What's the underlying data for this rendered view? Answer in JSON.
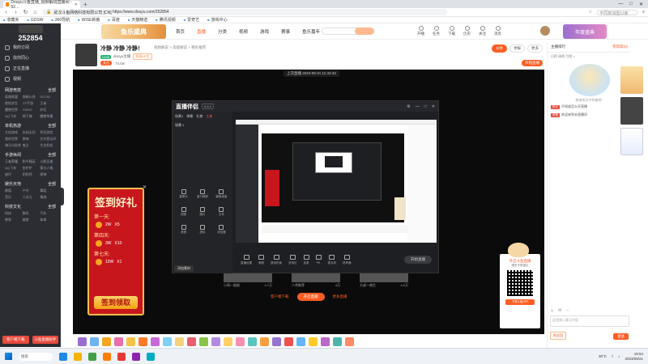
{
  "browser": {
    "tab_title": "Douyu斗鱼直播_视频解说直播间 - 52…",
    "url": "https://www.douyu.com/252854",
    "url_prefix": "武汉斗鱼网络科技有限公司 [CN]",
    "bookmarks": [
      "收藏夹",
      "GDSW",
      "360导航",
      "WISE新番",
      "百度",
      "天猫精选",
      "腾讯视频",
      "爱奇艺",
      "游戏中心"
    ],
    "search_placeholder": "不同意加盟13家"
  },
  "sidebar": {
    "room_number": "252854",
    "items": [
      "我的订阅",
      "找你同心",
      "正在直播",
      "视频"
    ],
    "groups": [
      {
        "title": "网游竞技",
        "more": "全部",
        "games": [
          "英雄联盟",
          "穿越火线",
          "DOTA2",
          "绝地求生",
          "CF手游",
          "王者",
          "魔兽世界",
          "CSGO",
          "炉石",
          "QQ飞车",
          "地下城",
          "魔兽争霸"
        ]
      },
      {
        "title": "单机热游",
        "more": "全部",
        "games": [
          "主机游戏",
          "永劫无间",
          "怀旧游戏",
          "我的世界",
          "原神",
          "艾尔登法环",
          "骑马与砍杀",
          "鬼泣",
          "生化危机"
        ]
      },
      {
        "title": "手游休闲",
        "more": "全部",
        "games": [
          "王者荣耀",
          "和平精英",
          "火影忍者",
          "QQ飞车",
          "金铲铲",
          "第五人格",
          "崩坏",
          "阴阳师",
          "原神"
        ]
      },
      {
        "title": "娱乐天地",
        "more": "全部",
        "games": [
          "颜值",
          "户外",
          "舞蹈",
          "音乐",
          "二次元",
          "情感"
        ]
      },
      {
        "title": "科技文化",
        "more": "全部",
        "games": [
          "科技",
          "数码",
          "汽车",
          "教育",
          "美食",
          "体育"
        ]
      }
    ],
    "bottom_buttons": [
      "客户端下载",
      "斗鱼直播助手"
    ]
  },
  "header": {
    "banner_left": "鱼乐盛典",
    "nav": [
      "首页",
      "直播",
      "分类",
      "视频",
      "游戏",
      "赛事",
      "鱼乐嘉年"
    ],
    "nav_active": "直播",
    "banner_search": "搜主播",
    "icons": [
      "开播",
      "任务",
      "下载",
      "历史",
      "关注",
      "消息"
    ],
    "banner_right": "年度盛典"
  },
  "room": {
    "title": "冷静 冷静 冷静！",
    "meta": "视频解说 > 高能解说 > 精彩推荐",
    "level": "LV45",
    "streamer": "douyu主播",
    "tag": "资深UP主",
    "follow": "关注",
    "follow_count": "74.0w",
    "share": "分享",
    "report": "举报",
    "more": "更多",
    "live_badge": "开始直播",
    "time_label": "上次直播",
    "time": "2023-09-21 11:43:43"
  },
  "signin": {
    "title": "签到好礼",
    "days": [
      {
        "label": "第一天:",
        "reward": "2W",
        "bonus": "X5"
      },
      {
        "label": "第四天:",
        "reward": "3W",
        "bonus": "X10"
      },
      {
        "label": "第七天:",
        "reward": "10W",
        "bonus": "X1"
      }
    ],
    "button": "签到领取"
  },
  "obs": {
    "logo": "直播伴侣",
    "version": "6.8.4",
    "tabs": [
      "场景1",
      "弹幕",
      "礼物",
      "工具"
    ],
    "scene": "场景 1",
    "tools": [
      "摄像头",
      "窗口捕获",
      "截取桌面",
      "视频",
      "图片",
      "文本",
      "音频",
      "虚拟",
      "浏览器"
    ],
    "add_source": "添加素材",
    "bottom": [
      "直播设置",
      "美颜",
      "虚拟形象",
      "多档位",
      "连麦",
      "PK",
      "麦克风",
      "扬声器"
    ],
    "start": "开始直播"
  },
  "recommend": {
    "items": [
      {
        "title": "小雨一剧剧",
        "count": "4.7万"
      },
      {
        "title": "八爷推荐",
        "count": "4万"
      },
      {
        "title": "大叔一夜生",
        "count": "4.0万"
      }
    ],
    "btn_left": "客户端下载",
    "btn_mid": "开启直播",
    "btn_right": "更多直播"
  },
  "qr": {
    "title": "开启斗鱼直播",
    "subtitle": "精彩不再错过",
    "button": "下载斗鱼APP"
  },
  "chat": {
    "tab_left": "主播排行",
    "tab_right": "贵宾席(0)",
    "rank_line": "日榜 周榜 月榜 >",
    "empty_text": "快来成为守护者吧~",
    "messages": [
      {
        "badge": "粉丝",
        "text": "不知道怎么开直播"
      },
      {
        "badge": "房管",
        "text": "欢迎来到本直播间"
      }
    ],
    "input_placeholder": "这里输入聊天内容",
    "fans": "粉丝团",
    "send": "发送"
  },
  "taskbar": {
    "search": "搜索",
    "time": "19:54",
    "date": "2023/09/21",
    "temp": "30°C"
  }
}
